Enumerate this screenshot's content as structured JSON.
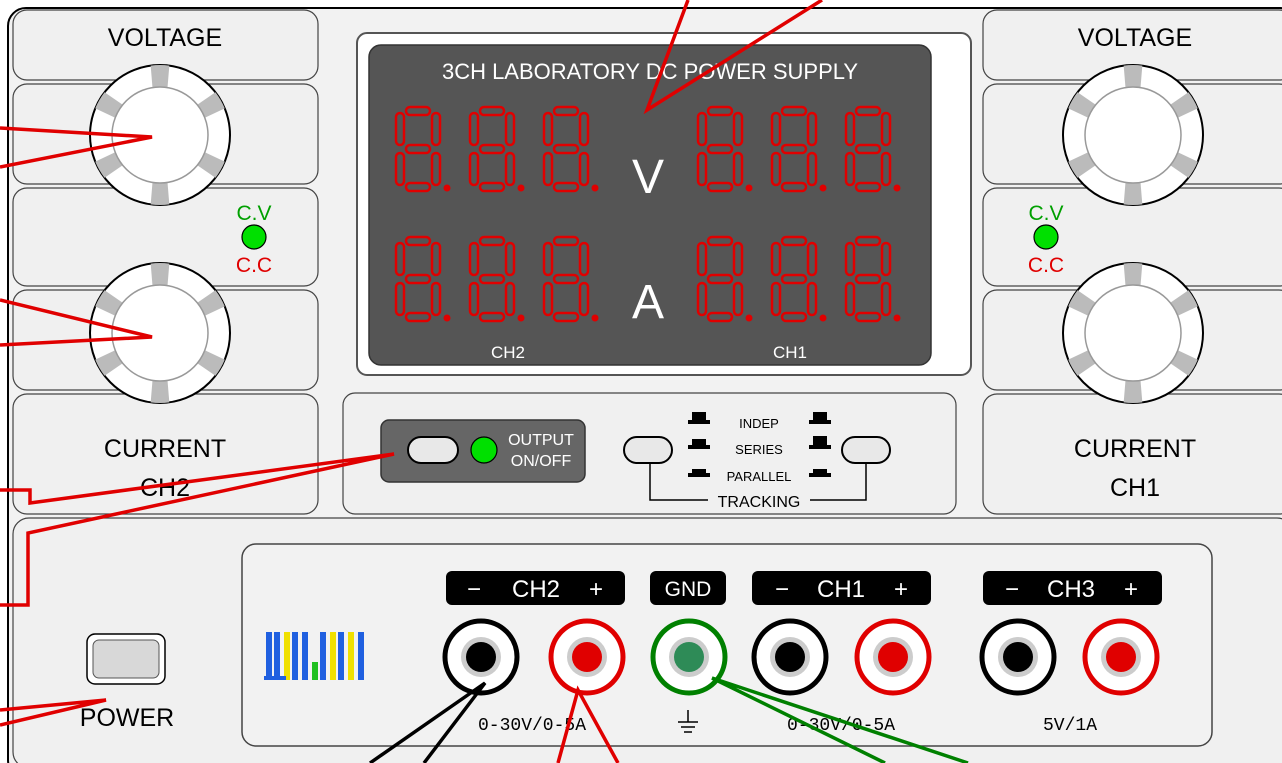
{
  "display": {
    "title": "3CH LABORATORY DC POWER SUPPLY",
    "volt_unit": "V",
    "amp_unit": "A",
    "ch2_label": "CH2",
    "ch1_label": "CH1",
    "digit_color": "#e00000"
  },
  "left_panel": {
    "voltage_label": "VOLTAGE",
    "current_label": "CURRENT",
    "channel_label": "CH2",
    "cv_label": "C.V",
    "cc_label": "C.C"
  },
  "right_panel": {
    "voltage_label": "VOLTAGE",
    "current_label": "CURRENT",
    "channel_label": "CH1",
    "cv_label": "C.V",
    "cc_label": "C.C"
  },
  "output": {
    "label_line1": "OUTPUT",
    "label_line2": "ON/OFF"
  },
  "tracking": {
    "modes": [
      "INDEP",
      "SERIES",
      "PARALLEL"
    ],
    "label": "TRACKING"
  },
  "power": {
    "label": "POWER"
  },
  "terminals": {
    "ch2": {
      "minus": "−",
      "name": "CH2",
      "plus": "+",
      "rating": "0-30V/0-5A"
    },
    "gnd": {
      "name": "GND"
    },
    "ch1": {
      "minus": "−",
      "name": "CH1",
      "plus": "+",
      "rating": "0-30V/0-5A"
    },
    "ch3": {
      "minus": "−",
      "name": "CH3",
      "plus": "+",
      "rating": "5V/1A"
    }
  },
  "colors": {
    "panel": "#e8e8e8",
    "display_bg": "#555555",
    "led_green": "#00e000",
    "wire_red": "#e00000",
    "wire_green": "#008000",
    "cv_text": "#00a000",
    "cc_text": "#e00000"
  }
}
